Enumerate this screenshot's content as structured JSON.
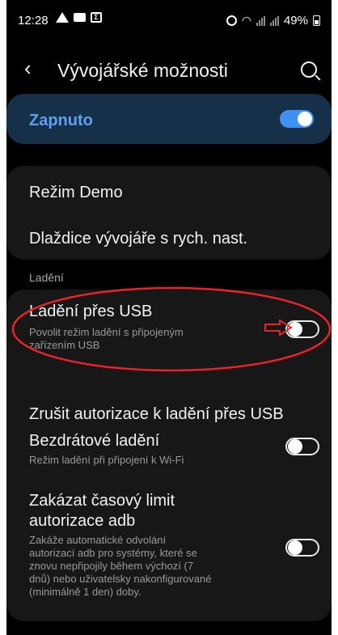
{
  "status_bar": {
    "time": "12:28",
    "battery": "49%"
  },
  "appbar": {
    "title": "Vývojářské možnosti",
    "icons": [
      "back-icon",
      "search-icon"
    ]
  },
  "master_toggle": {
    "label": "Zapnuto",
    "state": true
  },
  "top_card": {
    "items": [
      {
        "label": "Režim Demo"
      },
      {
        "label": "Dlaždice vývojáře s rych. nast."
      }
    ]
  },
  "debug_section": {
    "header": "Ladění",
    "usb_debugging": {
      "title": "Ladění přes USB",
      "desc1": "Povolit režim ladění s připojeným",
      "desc2": "zařízením USB",
      "state": false
    },
    "revoke": {
      "title": "Zrušit autorizace k ladění přes USB"
    },
    "wireless": {
      "title": "Bezdrátové ladění",
      "desc": "Režim ladění při připojení k Wi-Fi",
      "state": false
    },
    "adb_timeout": {
      "title1": "Zakázat časový limit",
      "title2": "autorizace adb",
      "desc1": "Zakáže automatické odvolání",
      "desc2": "autorizací adb pro systémy, které se",
      "desc3": "znovu nepřipojily během výchozí (7",
      "desc4": "dnů) nebo uživatelsky nakonfigurované",
      "desc5": "(minimálně 1 den) doby.",
      "state": false
    }
  },
  "colors": {
    "background": "#000000",
    "card": "#171717",
    "accent": "#3e91ef",
    "master_bg": "#16304a",
    "annotation": "#e8232a"
  }
}
